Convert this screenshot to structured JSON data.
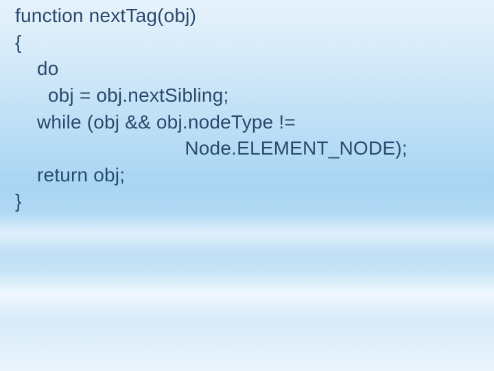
{
  "code": {
    "lines": [
      "function nextTag(obj)",
      "{",
      "    do",
      "      obj = obj.nextSibling;",
      "    while (obj && obj.nodeType !=",
      "                               Node.ELEMENT_NODE);",
      "    return obj;",
      "}"
    ]
  }
}
